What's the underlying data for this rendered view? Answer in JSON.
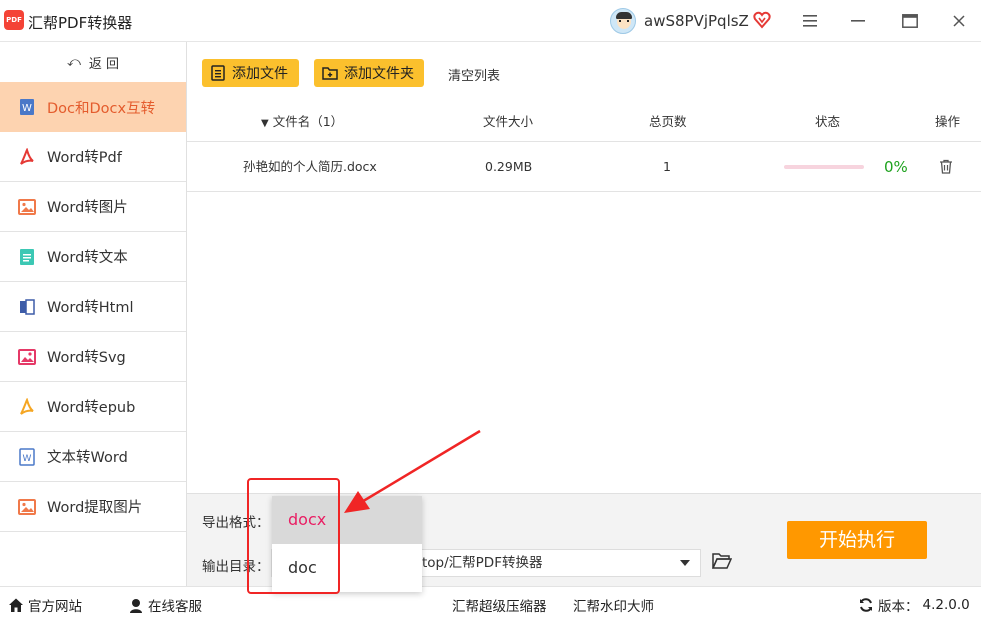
{
  "app": {
    "title": "汇帮PDF转换器",
    "logo_text": "PDF",
    "username": "awS8PVjPqlsZ"
  },
  "sidebar": {
    "back_label": "返 回",
    "items": [
      {
        "label": "Doc和Docx互转",
        "icon": "word-doc-icon",
        "active": true
      },
      {
        "label": "Word转Pdf",
        "icon": "pdf-icon"
      },
      {
        "label": "Word转图片",
        "icon": "image-icon"
      },
      {
        "label": "Word转文本",
        "icon": "text-file-icon"
      },
      {
        "label": "Word转Html",
        "icon": "html-icon"
      },
      {
        "label": "Word转Svg",
        "icon": "svg-image-icon"
      },
      {
        "label": "Word转epub",
        "icon": "epub-icon"
      },
      {
        "label": "文本转Word",
        "icon": "word-file-icon"
      },
      {
        "label": "Word提取图片",
        "icon": "extract-image-icon"
      }
    ]
  },
  "toolbar": {
    "add_file": "添加文件",
    "add_folder": "添加文件夹",
    "clear_list": "清空列表"
  },
  "table": {
    "headers": {
      "name": "文件名（1）",
      "size": "文件大小",
      "pages": "总页数",
      "status": "状态",
      "action": "操作"
    },
    "rows": [
      {
        "name": "孙艳如的个人简历.docx",
        "size": "0.29MB",
        "pages": "1",
        "progress_percent": 0,
        "status": "0%"
      }
    ]
  },
  "bottom": {
    "format_label": "导出格式：",
    "dir_label": "输出目录：",
    "dir_value": "top/汇帮PDF转换器",
    "start_button": "开始执行",
    "format_options": [
      "docx",
      "doc"
    ],
    "selected_format": "docx"
  },
  "footer": {
    "website": "官方网站",
    "service": "在线客服",
    "compress": "汇帮超级压缩器",
    "watermark": "汇帮水印大师",
    "version_label": "版本：",
    "version": "4.2.0.0"
  },
  "colors": {
    "accent": "#fbc02d",
    "active_bg": "#fdd3b0",
    "active_text": "#e45c2d",
    "start_button": "#ff9800",
    "annotation": "#f02525"
  }
}
